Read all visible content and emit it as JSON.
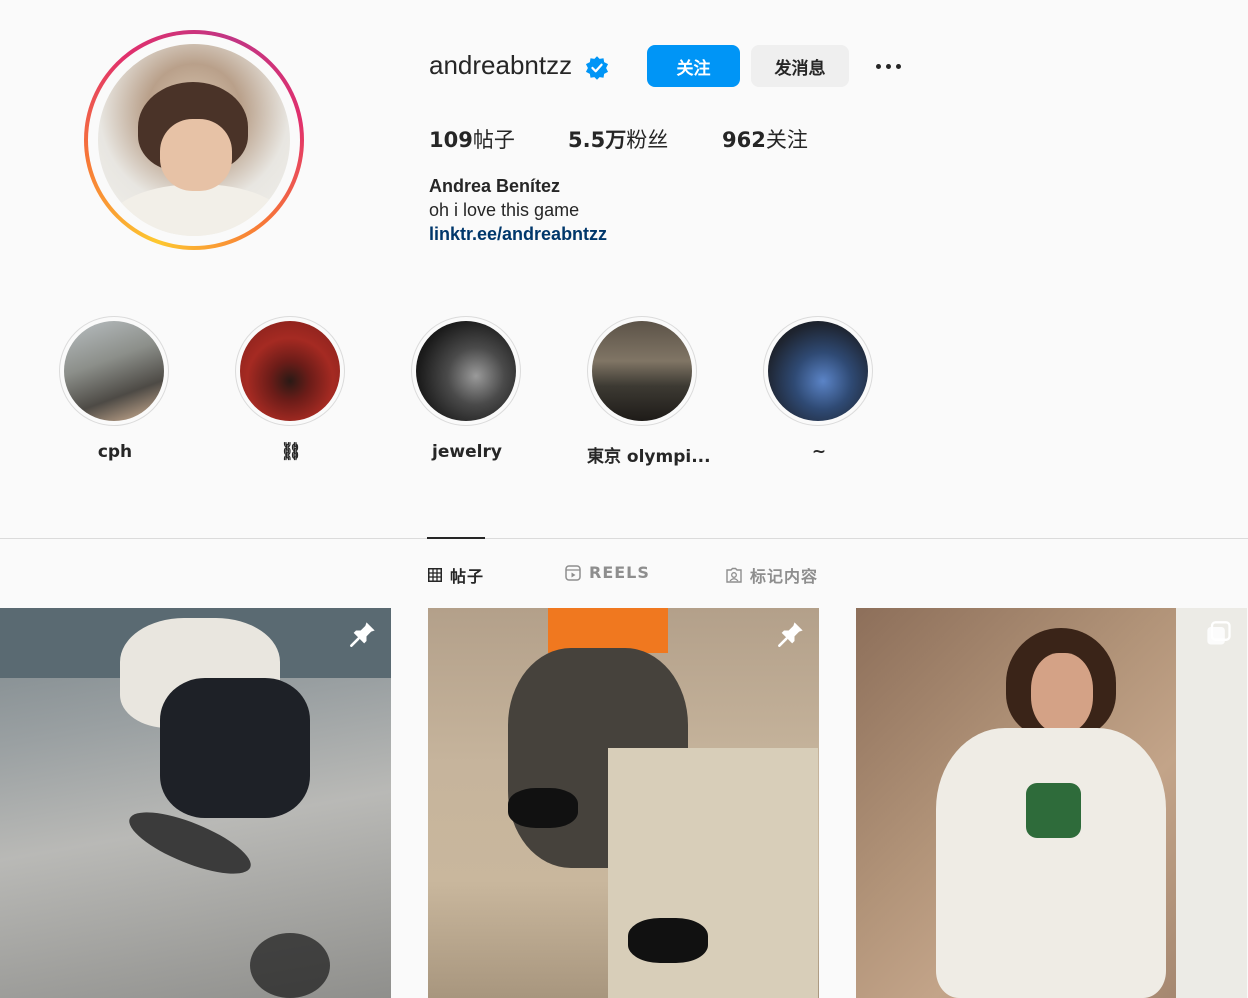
{
  "profile": {
    "username": "andreabntzz",
    "full_name": "Andrea Benítez",
    "bio": "oh i love this game",
    "link": "linktr.ee/andreabntzz",
    "follow_label": "关注",
    "message_label": "发消息",
    "verified": true
  },
  "stats": {
    "posts": "109",
    "posts_label": "帖子",
    "followers": "5.5万",
    "followers_label": "粉丝",
    "following": "962",
    "following_label": "关注"
  },
  "highlights": [
    {
      "label": "cph"
    },
    {
      "label": "⛓"
    },
    {
      "label": "jewelry"
    },
    {
      "label": "東京 olympi..."
    },
    {
      "label": "~"
    }
  ],
  "tabs": [
    {
      "label": "帖子",
      "icon": "grid-icon",
      "active": true
    },
    {
      "label": "REELS",
      "icon": "reels-icon",
      "active": false
    },
    {
      "label": "标记内容",
      "icon": "tagged-icon",
      "active": false
    }
  ],
  "posts": [
    {
      "indicator": "pin-icon"
    },
    {
      "indicator": "pin-icon"
    },
    {
      "indicator": "carousel-icon"
    }
  ],
  "colors": {
    "accent": "#0095f6",
    "link": "#00376b",
    "verified": "#0095f6"
  }
}
